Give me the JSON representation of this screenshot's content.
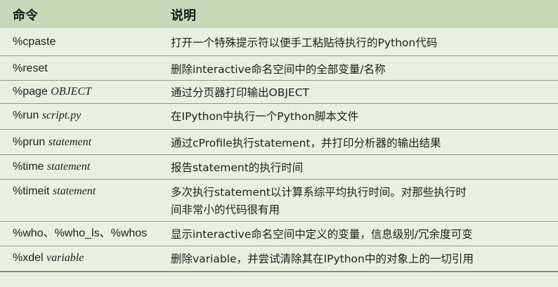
{
  "header": {
    "col_command": "命令",
    "col_description": "说明"
  },
  "rows": [
    {
      "cmd": "%cpaste",
      "arg": "",
      "desc": [
        "打开一个特殊提示符以便手工粘贴待执行的Python代码"
      ]
    },
    {
      "cmd": "%reset",
      "arg": "",
      "desc": [
        "删除interactive命名空间中的全部变量/名称"
      ]
    },
    {
      "cmd": "%page ",
      "arg": "OBJECT",
      "desc": [
        "通过分页器打印输出OBJECT"
      ]
    },
    {
      "cmd": "%run ",
      "arg": "script.py",
      "desc": [
        "在IPython中执行一个Python脚本文件"
      ]
    },
    {
      "cmd": "%prun ",
      "arg": "statement",
      "desc": [
        "通过cProfile执行statement，并打印分析器的输出结果"
      ]
    },
    {
      "cmd": "%time ",
      "arg": "statement",
      "desc": [
        "报告statement的执行时间"
      ]
    },
    {
      "cmd": "%timeit ",
      "arg": "statement",
      "desc": [
        "多次执行statement以计算系综平均执行时间。对那些执行时",
        "间非常小的代码很有用"
      ]
    },
    {
      "cmd": "%who、%who_ls、%whos",
      "arg": "",
      "desc": [
        "显示interactive命名空间中定义的变量，信息级别/冗余度可变"
      ]
    },
    {
      "cmd": "%xdel ",
      "arg": "variable",
      "desc": [
        "删除variable，并尝试清除其在IPython中的对象上的一切引用"
      ]
    }
  ]
}
